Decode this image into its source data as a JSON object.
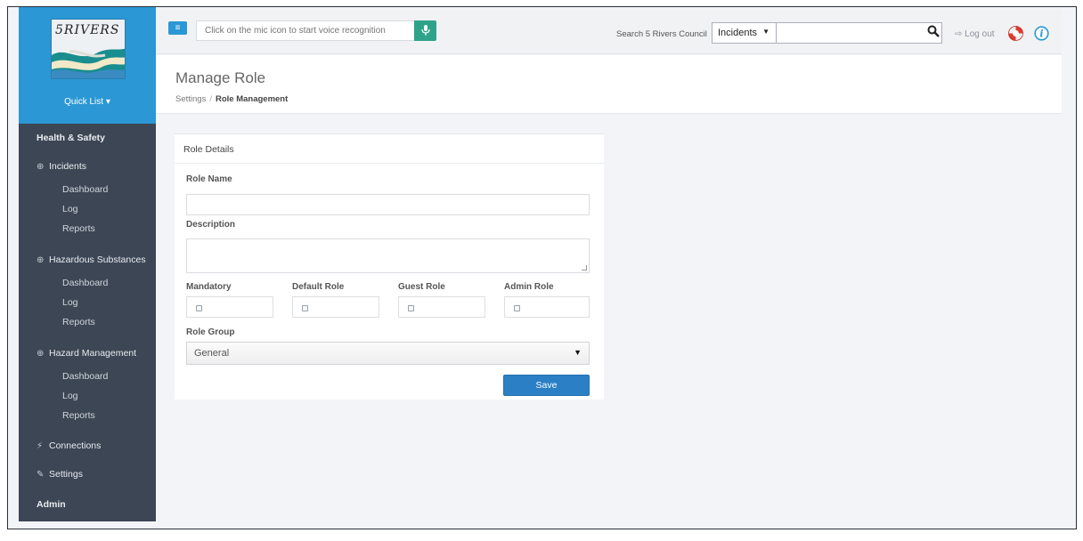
{
  "brand": {
    "logo_text": "5RIVERS"
  },
  "sidebar": {
    "quick_list": "Quick List ▾",
    "items": [
      {
        "label": "Health & Safety",
        "kind": "section"
      },
      {
        "label": "Incidents",
        "kind": "group",
        "icon": "expand-icon"
      },
      {
        "label": "Dashboard",
        "kind": "sub"
      },
      {
        "label": "Log",
        "kind": "sub"
      },
      {
        "label": "Reports",
        "kind": "sub"
      },
      {
        "label": "Hazardous Substances",
        "kind": "group",
        "icon": "expand-icon"
      },
      {
        "label": "Dashboard",
        "kind": "sub"
      },
      {
        "label": "Log",
        "kind": "sub"
      },
      {
        "label": "Reports",
        "kind": "sub"
      },
      {
        "label": "Hazard Management",
        "kind": "group",
        "icon": "expand-icon"
      },
      {
        "label": "Dashboard",
        "kind": "sub"
      },
      {
        "label": "Log",
        "kind": "sub"
      },
      {
        "label": "Reports",
        "kind": "sub"
      },
      {
        "label": "Connections",
        "kind": "group",
        "icon": "plug-icon"
      },
      {
        "label": "Settings",
        "kind": "group",
        "icon": "wrench-icon"
      },
      {
        "label": "Admin",
        "kind": "section"
      }
    ]
  },
  "topbar": {
    "menu_icon": "≡",
    "voice_placeholder": "Click on the mic icon to start voice recognition",
    "search_label": "Search 5 Rivers Council",
    "search_scope": "Incidents",
    "search_value": "",
    "logout_label": "Log out"
  },
  "header": {
    "title": "Manage Role",
    "breadcrumb": {
      "parent": "Settings",
      "separator": "/",
      "current": "Role Management"
    }
  },
  "form": {
    "panel_title": "Role Details",
    "role_name_label": "Role Name",
    "role_name_value": "",
    "description_label": "Description",
    "description_value": "",
    "checkboxes": [
      {
        "label": "Mandatory",
        "checked": false
      },
      {
        "label": "Default Role",
        "checked": false
      },
      {
        "label": "Guest Role",
        "checked": false
      },
      {
        "label": "Admin Role",
        "checked": false
      }
    ],
    "role_group_label": "Role Group",
    "role_group_value": "General",
    "save_label": "Save"
  },
  "colors": {
    "sidebar_bg": "#3d4654",
    "sidebar_header_bg": "#2b97d4",
    "primary_button": "#2b7fc5",
    "mic_button": "#2ea38a",
    "content_bg": "#f3f4f7"
  }
}
